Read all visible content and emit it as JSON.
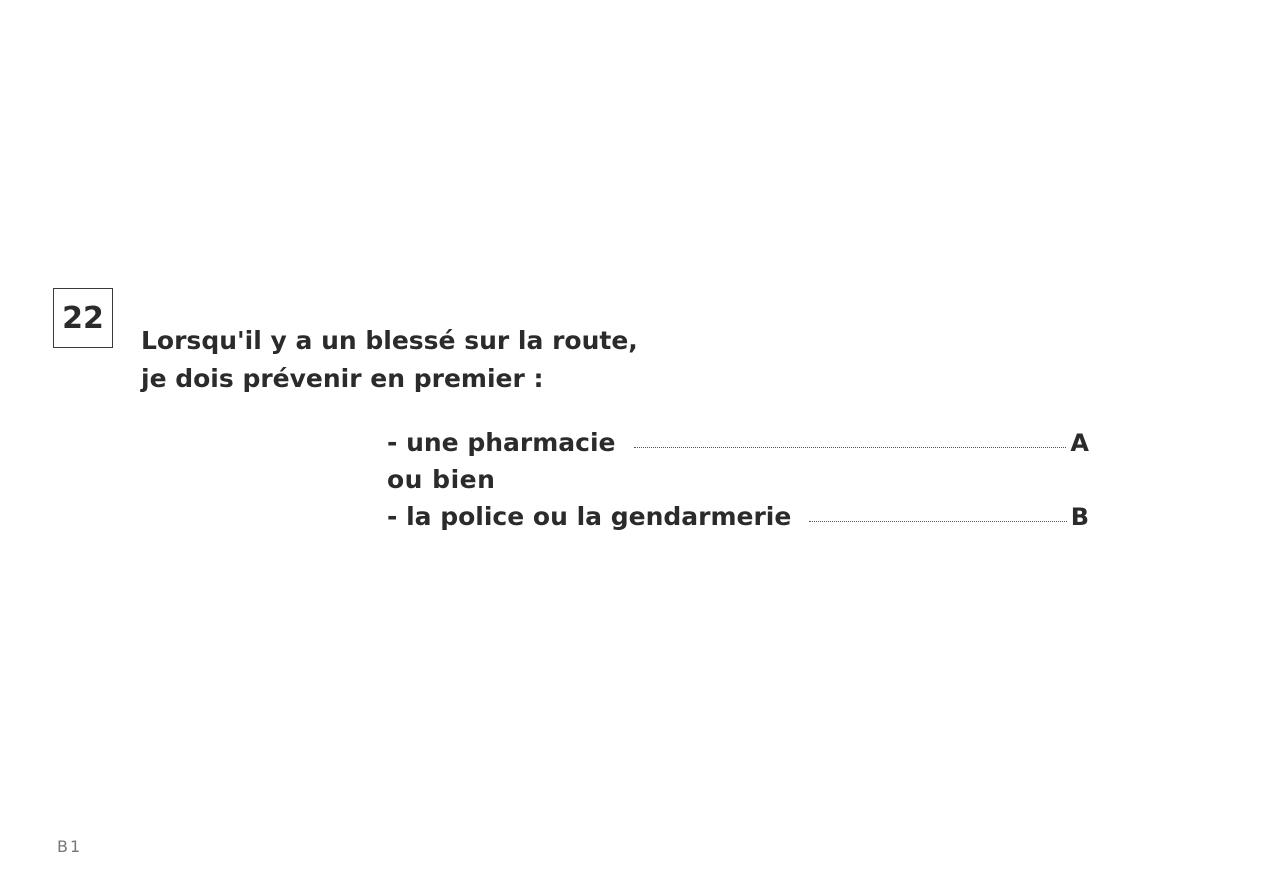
{
  "question": {
    "number": "22",
    "line1": "Lorsqu'il y a un blessé sur la route,",
    "line2": "je dois prévenir en premier :"
  },
  "answers": {
    "option_a": {
      "text": "- une pharmacie",
      "letter": "A"
    },
    "separator": "ou bien",
    "option_b": {
      "text": "- la police ou la gendarmerie",
      "letter": "B"
    }
  },
  "footer": {
    "code": "B1"
  }
}
